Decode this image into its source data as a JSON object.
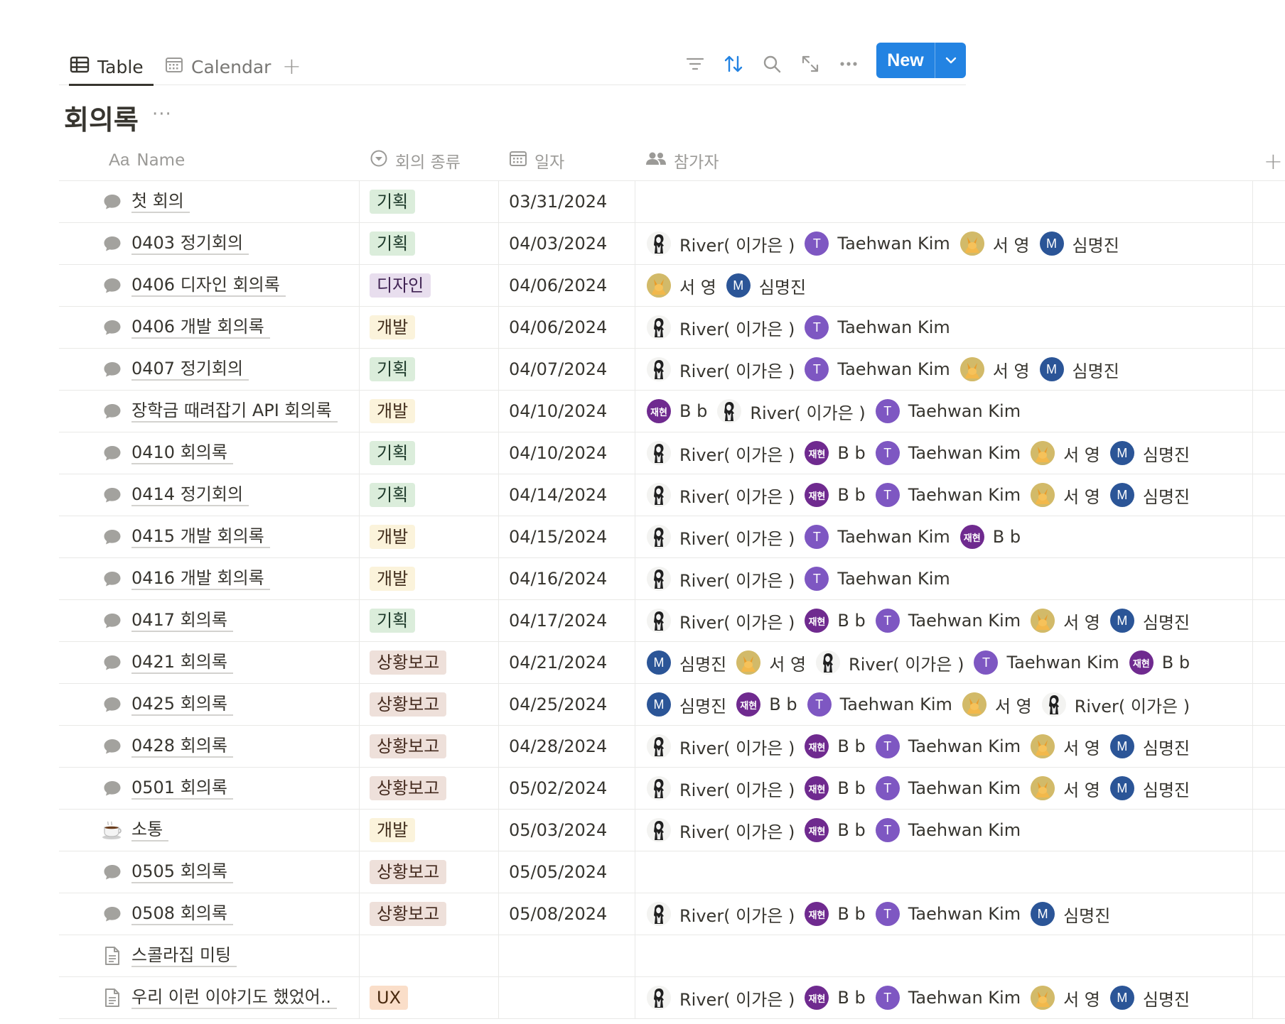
{
  "views": [
    {
      "label": "Table",
      "icon": "table-icon",
      "active": true
    },
    {
      "label": "Calendar",
      "icon": "calendar-icon",
      "active": false
    }
  ],
  "toolbar": {
    "add_view": "+",
    "more": "···",
    "new_label": "New",
    "tools": [
      "filter-icon",
      "sort-icon",
      "search-icon",
      "expand-icon",
      "more-icon",
      "chevron-down-icon"
    ],
    "active_tool_color": "#2383e2",
    "button_color": "#2383e2"
  },
  "database": {
    "title": "회의록",
    "more": "···"
  },
  "columns": {
    "name": {
      "icon": "Aa",
      "label": "Name"
    },
    "type": {
      "label": "회의 종류",
      "icon": "select-icon"
    },
    "date": {
      "label": "일자",
      "icon": "calendar-icon"
    },
    "participants": {
      "label": "참가자",
      "icon": "people-icon"
    },
    "add": "+"
  },
  "tag_colors": {
    "기획": {
      "bg": "#dbeddb",
      "fg": "#1c3829"
    },
    "디자인": {
      "bg": "#e8deee",
      "fg": "#412454"
    },
    "개발": {
      "bg": "#fbf3db",
      "fg": "#402c1b"
    },
    "상황보고": {
      "bg": "#eee0da",
      "fg": "#442a1e"
    },
    "UX": {
      "bg": "#fadec9",
      "fg": "#49290e"
    }
  },
  "people": {
    "river": {
      "name": "River( 이가은 )",
      "avatar": "photo-bw",
      "color": "#f1f1ef"
    },
    "taehwan": {
      "name": "Taehwan Kim",
      "avatar": "T",
      "color": "#7e57c2"
    },
    "seo": {
      "name": "서 영",
      "avatar": "photo-yellow",
      "color": "#e0c062"
    },
    "shim": {
      "name": "심명진",
      "avatar": "M",
      "color": "#2b5597"
    },
    "bb": {
      "name": "B b",
      "avatar": "재현",
      "color": "#6f2a8f"
    }
  },
  "rows": [
    {
      "icon": "chat-icon",
      "name": "첫 회의",
      "type": "기획",
      "date": "03/31/2024",
      "participants": []
    },
    {
      "icon": "chat-icon",
      "name": "0403 정기회의",
      "type": "기획",
      "date": "04/03/2024",
      "participants": [
        "river",
        "taehwan",
        "seo",
        "shim"
      ]
    },
    {
      "icon": "chat-icon",
      "name": "0406 디자인 회의록",
      "type": "디자인",
      "date": "04/06/2024",
      "participants": [
        "seo",
        "shim"
      ]
    },
    {
      "icon": "chat-icon",
      "name": "0406 개발 회의록",
      "type": "개발",
      "date": "04/06/2024",
      "participants": [
        "river",
        "taehwan"
      ]
    },
    {
      "icon": "chat-icon",
      "name": "0407 정기회의",
      "type": "기획",
      "date": "04/07/2024",
      "participants": [
        "river",
        "taehwan",
        "seo",
        "shim"
      ]
    },
    {
      "icon": "chat-icon",
      "name": "장학금 때려잡기 API 회의록",
      "type": "개발",
      "date": "04/10/2024",
      "participants": [
        "bb",
        "river",
        "taehwan"
      ]
    },
    {
      "icon": "chat-icon",
      "name": "0410 회의록",
      "type": "기획",
      "date": "04/10/2024",
      "participants": [
        "river",
        "bb",
        "taehwan",
        "seo",
        "shim"
      ]
    },
    {
      "icon": "chat-icon",
      "name": "0414 정기회의",
      "type": "기획",
      "date": "04/14/2024",
      "participants": [
        "river",
        "bb",
        "taehwan",
        "seo",
        "shim"
      ]
    },
    {
      "icon": "chat-icon",
      "name": "0415 개발 회의록",
      "type": "개발",
      "date": "04/15/2024",
      "participants": [
        "river",
        "taehwan",
        "bb"
      ]
    },
    {
      "icon": "chat-icon",
      "name": "0416 개발 회의록",
      "type": "개발",
      "date": "04/16/2024",
      "participants": [
        "river",
        "taehwan"
      ]
    },
    {
      "icon": "chat-icon",
      "name": "0417 회의록",
      "type": "기획",
      "date": "04/17/2024",
      "participants": [
        "river",
        "bb",
        "taehwan",
        "seo",
        "shim"
      ]
    },
    {
      "icon": "chat-icon",
      "name": "0421 회의록",
      "type": "상황보고",
      "date": "04/21/2024",
      "participants": [
        "shim",
        "seo",
        "river",
        "taehwan",
        "bb"
      ]
    },
    {
      "icon": "chat-icon",
      "name": "0425 회의록",
      "type": "상황보고",
      "date": "04/25/2024",
      "participants": [
        "shim",
        "bb",
        "taehwan",
        "seo",
        "river"
      ]
    },
    {
      "icon": "chat-icon",
      "name": "0428 회의록",
      "type": "상황보고",
      "date": "04/28/2024",
      "participants": [
        "river",
        "bb",
        "taehwan",
        "seo",
        "shim"
      ]
    },
    {
      "icon": "chat-icon",
      "name": "0501 회의록",
      "type": "상황보고",
      "date": "05/02/2024",
      "participants": [
        "river",
        "bb",
        "taehwan",
        "seo",
        "shim"
      ]
    },
    {
      "icon": "coffee-icon",
      "name": "소통",
      "type": "개발",
      "date": "05/03/2024",
      "participants": [
        "river",
        "bb",
        "taehwan"
      ]
    },
    {
      "icon": "chat-icon",
      "name": "0505 회의록",
      "type": "상황보고",
      "date": "05/05/2024",
      "participants": []
    },
    {
      "icon": "chat-icon",
      "name": "0508 회의록",
      "type": "상황보고",
      "date": "05/08/2024",
      "participants": [
        "river",
        "bb",
        "taehwan",
        "shim"
      ]
    },
    {
      "icon": "page-icon",
      "name": "스콜라집 미팅",
      "type": "",
      "date": "",
      "participants": []
    },
    {
      "icon": "page-icon",
      "name": "우리 이런 이야기도 했었어..",
      "type": "UX",
      "date": "",
      "participants": [
        "river",
        "bb",
        "taehwan",
        "seo",
        "shim"
      ]
    }
  ]
}
